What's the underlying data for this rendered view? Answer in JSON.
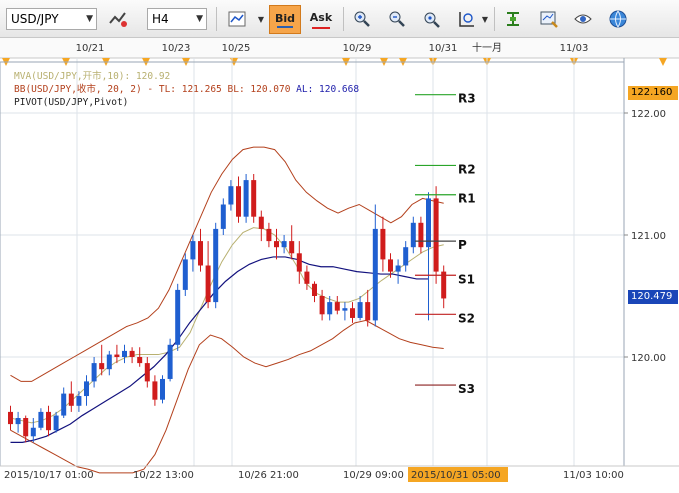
{
  "toolbar": {
    "symbol": "USD/JPY",
    "timeframe": "H4",
    "bid_label": "Bid",
    "ask_label": "Ask"
  },
  "legend": {
    "mva": "MVA(USD/JPY,开市,10): 120.92",
    "bb_prefix": "BB(USD/JPY,收市, 20, 2) -",
    "bb_tl": "TL: 121.265",
    "bb_bl": "BL: 120.070",
    "bb_al": "AL: 120.668",
    "pivot": "PIVOT(USD/JPY,Pivot)"
  },
  "top_dates": [
    "10/21",
    "10/23",
    "10/25",
    "10/29",
    "10/31",
    "十一月",
    "11/03"
  ],
  "bottom_dates": [
    "2015/10/17  01:00",
    "10/22  13:00",
    "10/26  21:00",
    "10/29  09:00",
    "2015/10/31  05:00",
    "11/03  10:00"
  ],
  "price_axis": [
    "122.00",
    "121.00",
    "120.00"
  ],
  "price_boxes": {
    "top": "122.160",
    "current": "120.479"
  },
  "pivot_labels": [
    "R3",
    "R2",
    "R1",
    "P",
    "S1",
    "S2",
    "S3"
  ],
  "colors": {
    "bull": "#1f5fd0",
    "bear": "#d01c1c",
    "bb": "#b3401c",
    "ma": "#b8b070",
    "slow": "#13127e",
    "highlight": "#f5a623"
  },
  "chart_data": {
    "type": "candlestick",
    "symbol": "USD/JPY",
    "interval": "H4",
    "ylim": [
      119.2,
      122.4
    ],
    "pivots": {
      "R3": 122.15,
      "R2": 121.57,
      "R1": 121.33,
      "P": 120.95,
      "S1": 120.67,
      "S2": 120.35,
      "S3": 119.77
    },
    "ohlc": [
      [
        119.55,
        119.6,
        119.4,
        119.45
      ],
      [
        119.45,
        119.55,
        119.38,
        119.5
      ],
      [
        119.5,
        119.52,
        119.3,
        119.35
      ],
      [
        119.35,
        119.5,
        119.3,
        119.42
      ],
      [
        119.42,
        119.58,
        119.4,
        119.55
      ],
      [
        119.55,
        119.6,
        119.35,
        119.4
      ],
      [
        119.4,
        119.55,
        119.38,
        119.52
      ],
      [
        119.52,
        119.75,
        119.5,
        119.7
      ],
      [
        119.7,
        119.8,
        119.55,
        119.6
      ],
      [
        119.6,
        119.72,
        119.55,
        119.68
      ],
      [
        119.68,
        119.85,
        119.6,
        119.8
      ],
      [
        119.8,
        120.0,
        119.75,
        119.95
      ],
      [
        119.95,
        120.1,
        119.85,
        119.9
      ],
      [
        119.9,
        120.05,
        119.85,
        120.02
      ],
      [
        120.02,
        120.1,
        119.95,
        120.0
      ],
      [
        120.0,
        120.1,
        119.95,
        120.05
      ],
      [
        120.05,
        120.08,
        119.95,
        120.0
      ],
      [
        120.0,
        120.08,
        119.92,
        119.95
      ],
      [
        119.95,
        120.0,
        119.75,
        119.8
      ],
      [
        119.8,
        119.85,
        119.6,
        119.65
      ],
      [
        119.65,
        119.85,
        119.62,
        119.82
      ],
      [
        119.82,
        120.15,
        119.8,
        120.1
      ],
      [
        120.1,
        120.6,
        120.05,
        120.55
      ],
      [
        120.55,
        120.85,
        120.5,
        120.8
      ],
      [
        120.8,
        121.0,
        120.7,
        120.95
      ],
      [
        120.95,
        121.05,
        120.7,
        120.75
      ],
      [
        120.75,
        120.95,
        120.4,
        120.45
      ],
      [
        120.45,
        121.1,
        120.4,
        121.05
      ],
      [
        121.05,
        121.3,
        121.0,
        121.25
      ],
      [
        121.25,
        121.45,
        121.2,
        121.4
      ],
      [
        121.4,
        121.48,
        121.1,
        121.15
      ],
      [
        121.15,
        121.5,
        121.1,
        121.45
      ],
      [
        121.45,
        121.5,
        121.1,
        121.15
      ],
      [
        121.15,
        121.2,
        120.95,
        121.05
      ],
      [
        121.05,
        121.1,
        120.9,
        120.95
      ],
      [
        120.95,
        121.05,
        120.8,
        120.9
      ],
      [
        120.9,
        121.0,
        120.85,
        120.95
      ],
      [
        120.95,
        121.08,
        120.8,
        120.85
      ],
      [
        120.85,
        120.95,
        120.6,
        120.7
      ],
      [
        120.7,
        120.75,
        120.55,
        120.6
      ],
      [
        120.6,
        120.62,
        120.45,
        120.5
      ],
      [
        120.5,
        120.55,
        120.3,
        120.35
      ],
      [
        120.35,
        120.5,
        120.3,
        120.45
      ],
      [
        120.45,
        120.5,
        120.35,
        120.38
      ],
      [
        120.38,
        120.45,
        120.3,
        120.4
      ],
      [
        120.4,
        120.45,
        120.28,
        120.32
      ],
      [
        120.32,
        120.5,
        120.3,
        120.45
      ],
      [
        120.45,
        120.55,
        120.25,
        120.3
      ],
      [
        120.3,
        121.25,
        120.25,
        121.05
      ],
      [
        121.05,
        121.15,
        120.7,
        120.8
      ],
      [
        120.8,
        120.85,
        120.65,
        120.7
      ],
      [
        120.7,
        120.8,
        120.6,
        120.75
      ],
      [
        120.75,
        120.95,
        120.7,
        120.9
      ],
      [
        120.9,
        121.15,
        120.85,
        121.1
      ],
      [
        121.1,
        121.15,
        120.85,
        120.9
      ],
      [
        120.9,
        121.35,
        120.3,
        121.3
      ],
      [
        121.3,
        121.4,
        120.6,
        120.7
      ],
      [
        120.7,
        120.75,
        120.4,
        120.48
      ]
    ],
    "bb_upper": [
      119.85,
      119.8,
      119.8,
      119.85,
      119.9,
      119.95,
      120.0,
      120.05,
      120.1,
      120.15,
      120.2,
      120.25,
      120.28,
      120.32,
      120.4,
      120.55,
      120.75,
      120.95,
      121.15,
      121.35,
      121.5,
      121.62,
      121.7,
      121.72,
      121.72,
      121.7,
      121.6,
      121.45,
      121.35,
      121.28,
      121.22,
      121.18,
      121.22,
      121.25,
      121.2,
      121.15,
      121.1,
      121.15,
      121.25,
      121.3,
      121.28,
      121.26
    ],
    "bb_lower": [
      119.4,
      119.35,
      119.3,
      119.25,
      119.2,
      119.15,
      119.1,
      119.08,
      119.05,
      119.05,
      119.05,
      119.05,
      119.08,
      119.2,
      119.4,
      119.65,
      119.9,
      120.1,
      120.18,
      120.15,
      120.08,
      120.0,
      119.95,
      119.92,
      119.95,
      119.98,
      120.02,
      120.05,
      120.1,
      120.15,
      120.22,
      120.28,
      120.3,
      120.25,
      120.2,
      120.15,
      120.12,
      120.1,
      120.08,
      120.07
    ],
    "ma_fast": [
      119.5,
      119.48,
      119.46,
      119.48,
      119.52,
      119.58,
      119.66,
      119.74,
      119.82,
      119.9,
      119.96,
      120.0,
      120.02,
      120.02,
      120.02,
      120.04,
      120.08,
      120.2,
      120.4,
      120.6,
      120.78,
      120.92,
      121.02,
      121.06,
      121.05,
      121.0,
      120.9,
      120.76,
      120.6,
      120.52,
      120.48,
      120.45,
      120.45,
      120.48,
      120.55,
      120.62,
      120.68,
      120.74,
      120.8,
      120.86,
      120.9,
      120.92
    ],
    "ma_slow": [
      119.3,
      119.3,
      119.32,
      119.35,
      119.4,
      119.45,
      119.52,
      119.58,
      119.64,
      119.7,
      119.76,
      119.84,
      119.92,
      120.02,
      120.14,
      120.28,
      120.4,
      120.52,
      120.62,
      120.7,
      120.76,
      120.8,
      120.82,
      120.82,
      120.8,
      120.76,
      120.74,
      120.74,
      120.72,
      120.7,
      120.69,
      120.68,
      120.68,
      120.66,
      120.64,
      120.64
    ]
  }
}
